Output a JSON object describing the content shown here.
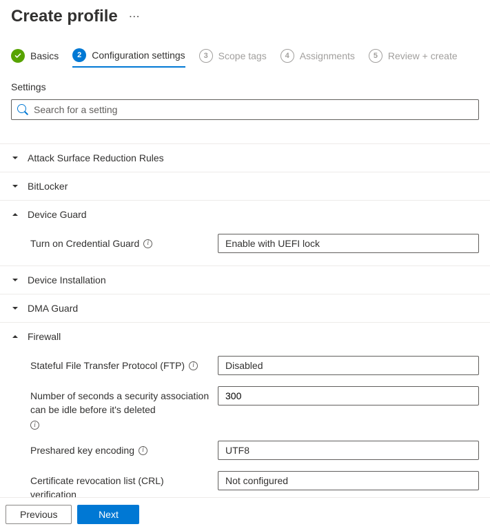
{
  "header": {
    "title": "Create profile"
  },
  "steps": [
    {
      "label": "Basics",
      "state": "completed",
      "num": ""
    },
    {
      "label": "Configuration settings",
      "state": "active",
      "num": "2"
    },
    {
      "label": "Scope tags",
      "state": "inactive",
      "num": "3"
    },
    {
      "label": "Assignments",
      "state": "inactive",
      "num": "4"
    },
    {
      "label": "Review + create",
      "state": "inactive",
      "num": "5"
    }
  ],
  "section_title": "Settings",
  "search": {
    "placeholder": "Search for a setting"
  },
  "categories": [
    {
      "label": "Attack Surface Reduction Rules",
      "expanded": false
    },
    {
      "label": "BitLocker",
      "expanded": false
    },
    {
      "label": "Device Guard",
      "expanded": true,
      "settings": [
        {
          "label": "Turn on Credential Guard",
          "type": "dropdown",
          "value": "Enable with UEFI lock"
        }
      ]
    },
    {
      "label": "Device Installation",
      "expanded": false
    },
    {
      "label": "DMA Guard",
      "expanded": false
    },
    {
      "label": "Firewall",
      "expanded": true,
      "settings": [
        {
          "label": "Stateful File Transfer Protocol (FTP)",
          "type": "dropdown",
          "value": "Disabled"
        },
        {
          "label": "Number of seconds a security association can be idle before it's deleted",
          "type": "text",
          "value": "300"
        },
        {
          "label": "Preshared key encoding",
          "type": "dropdown",
          "value": "UTF8"
        },
        {
          "label": "Certificate revocation list (CRL) verification",
          "type": "dropdown",
          "value": "Not configured"
        }
      ]
    }
  ],
  "footer": {
    "previous": "Previous",
    "next": "Next"
  }
}
